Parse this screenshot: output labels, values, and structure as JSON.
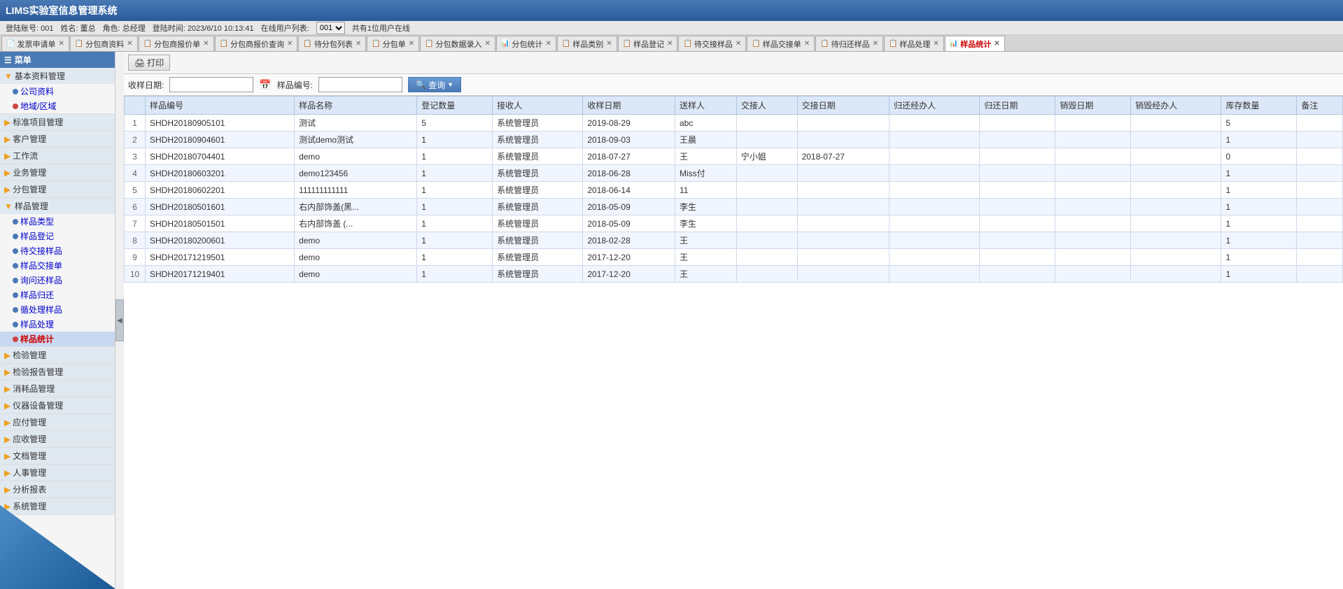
{
  "app": {
    "title": "LIMS实验室信息管理系统"
  },
  "info_bar": {
    "login_text": "登陆账号: 001",
    "name_text": "姓名: 董总",
    "role_text": "角色: 总经理",
    "login_time_text": "登陆时间: 2023/6/10 10:13:41",
    "online_text": "在线用户列表:",
    "online_select": "001",
    "online_count": "共有1位用户在线"
  },
  "tabs": [
    {
      "label": "发票申请单",
      "active": false,
      "closable": true,
      "icon": "📄"
    },
    {
      "label": "分包商资料",
      "active": false,
      "closable": true,
      "icon": "📋"
    },
    {
      "label": "分包商报价单",
      "active": false,
      "closable": true,
      "icon": "📋"
    },
    {
      "label": "分包商报价查询",
      "active": false,
      "closable": true,
      "icon": "📋"
    },
    {
      "label": "待分包列表",
      "active": false,
      "closable": true,
      "icon": "📋"
    },
    {
      "label": "分包单",
      "active": false,
      "closable": true,
      "icon": "📋"
    },
    {
      "label": "分包数据录入",
      "active": false,
      "closable": true,
      "icon": "📋"
    },
    {
      "label": "分包统计",
      "active": false,
      "closable": true,
      "icon": "📊"
    },
    {
      "label": "样品类别",
      "active": false,
      "closable": true,
      "icon": "📋"
    },
    {
      "label": "样品登记",
      "active": false,
      "closable": true,
      "icon": "📋"
    },
    {
      "label": "待交接样品",
      "active": false,
      "closable": true,
      "icon": "📋"
    },
    {
      "label": "样品交接单",
      "active": false,
      "closable": true,
      "icon": "📋"
    },
    {
      "label": "待归还样品",
      "active": false,
      "closable": true,
      "icon": "📋"
    },
    {
      "label": "样品处理",
      "active": false,
      "closable": true,
      "icon": "📋"
    },
    {
      "label": "样品统计",
      "active": true,
      "closable": true,
      "icon": "📊"
    }
  ],
  "sidebar": {
    "menu_label": "菜单",
    "groups": [
      {
        "label": "基本资料管理",
        "icon": "folder",
        "expanded": true,
        "items": [
          {
            "label": "公司资料",
            "active": false,
            "icon": "file"
          },
          {
            "label": "地域/区域",
            "active": false,
            "icon": "file"
          }
        ]
      },
      {
        "label": "标准项目管理",
        "icon": "folder",
        "expanded": false,
        "items": []
      },
      {
        "label": "客户管理",
        "icon": "folder",
        "expanded": false,
        "items": []
      },
      {
        "label": "工作流",
        "icon": "folder",
        "expanded": false,
        "items": []
      },
      {
        "label": "业务管理",
        "icon": "folder",
        "expanded": false,
        "items": []
      },
      {
        "label": "分包管理",
        "icon": "folder",
        "expanded": false,
        "items": []
      },
      {
        "label": "样品管理",
        "icon": "folder",
        "expanded": true,
        "items": [
          {
            "label": "样品类型",
            "active": false
          },
          {
            "label": "样品登记",
            "active": false
          },
          {
            "label": "待交接样品",
            "active": false
          },
          {
            "label": "样品交接单",
            "active": false
          },
          {
            "label": "询问还样品",
            "active": false
          },
          {
            "label": "样品归还",
            "active": false
          },
          {
            "label": "循处理样品",
            "active": false
          },
          {
            "label": "样品处理",
            "active": false
          },
          {
            "label": "样品统计",
            "active": true
          }
        ]
      },
      {
        "label": "检验管理",
        "icon": "folder",
        "expanded": false,
        "items": []
      },
      {
        "label": "检验报告管理",
        "icon": "folder",
        "expanded": false,
        "items": []
      },
      {
        "label": "消耗品管理",
        "icon": "folder",
        "expanded": false,
        "items": []
      },
      {
        "label": "仪器设备管理",
        "icon": "folder",
        "expanded": false,
        "items": []
      },
      {
        "label": "应付管理",
        "icon": "folder",
        "expanded": false,
        "items": []
      },
      {
        "label": "应收管理",
        "icon": "folder",
        "expanded": false,
        "items": []
      },
      {
        "label": "文档管理",
        "icon": "folder",
        "expanded": false,
        "items": []
      },
      {
        "label": "人事管理",
        "icon": "folder",
        "expanded": false,
        "items": []
      },
      {
        "label": "分析报表",
        "icon": "folder",
        "expanded": false,
        "items": []
      },
      {
        "label": "系统管理",
        "icon": "folder",
        "expanded": false,
        "items": []
      }
    ]
  },
  "toolbar": {
    "print_label": "打印",
    "print_icon": "🖨"
  },
  "search": {
    "date_label": "收样日期:",
    "date_placeholder": "",
    "sample_code_label": "样品编号:",
    "sample_code_placeholder": "",
    "search_btn_label": "查询",
    "search_icon": "🔍"
  },
  "table": {
    "columns": [
      {
        "label": "样品编号",
        "key": "sample_code"
      },
      {
        "label": "样品名称",
        "key": "sample_name"
      },
      {
        "label": "登记数量",
        "key": "reg_count"
      },
      {
        "label": "接收人",
        "key": "receiver"
      },
      {
        "label": "收样日期",
        "key": "receive_date"
      },
      {
        "label": "送样人",
        "key": "sender"
      },
      {
        "label": "交接人",
        "key": "handover"
      },
      {
        "label": "交接日期",
        "key": "handover_date"
      },
      {
        "label": "归还经办人",
        "key": "return_handler"
      },
      {
        "label": "归还日期",
        "key": "return_date"
      },
      {
        "label": "销毁日期",
        "key": "destroy_date"
      },
      {
        "label": "销毁经办人",
        "key": "destroy_handler"
      },
      {
        "label": "库存数量",
        "key": "stock_count"
      },
      {
        "label": "备注",
        "key": "note"
      }
    ],
    "rows": [
      {
        "no": 1,
        "sample_code": "SHDH20180905101",
        "sample_name": "测试",
        "reg_count": 5,
        "receiver": "系统管理员",
        "receive_date": "2019-08-29",
        "sender": "abc",
        "handover": "",
        "handover_date": "",
        "return_handler": "",
        "return_date": "",
        "destroy_date": "",
        "destroy_handler": "",
        "stock_count": 5,
        "note": ""
      },
      {
        "no": 2,
        "sample_code": "SHDH20180904601",
        "sample_name": "测试demo测试",
        "reg_count": 1,
        "receiver": "系统管理员",
        "receive_date": "2018-09-03",
        "sender": "王晨",
        "handover": "",
        "handover_date": "",
        "return_handler": "",
        "return_date": "",
        "destroy_date": "",
        "destroy_handler": "",
        "stock_count": 1,
        "note": ""
      },
      {
        "no": 3,
        "sample_code": "SHDH20180704401",
        "sample_name": "demo",
        "reg_count": 1,
        "receiver": "系统管理员",
        "receive_date": "2018-07-27",
        "sender": "王",
        "handover": "宁小姐",
        "handover_date": "2018-07-27",
        "return_handler": "",
        "return_date": "",
        "destroy_date": "",
        "destroy_handler": "",
        "stock_count": 0,
        "note": ""
      },
      {
        "no": 4,
        "sample_code": "SHDH20180603201",
        "sample_name": "demo123456",
        "reg_count": 1,
        "receiver": "系统管理员",
        "receive_date": "2018-06-28",
        "sender": "Miss付",
        "handover": "",
        "handover_date": "",
        "return_handler": "",
        "return_date": "",
        "destroy_date": "",
        "destroy_handler": "",
        "stock_count": 1,
        "note": ""
      },
      {
        "no": 5,
        "sample_code": "SHDH20180602201",
        "sample_name": "111111111111",
        "reg_count": 1,
        "receiver": "系统管理员",
        "receive_date": "2018-06-14",
        "sender": "11",
        "handover": "",
        "handover_date": "",
        "return_handler": "",
        "return_date": "",
        "destroy_date": "",
        "destroy_handler": "",
        "stock_count": 1,
        "note": ""
      },
      {
        "no": 6,
        "sample_code": "SHDH20180501601",
        "sample_name": "右内部饰盖(黑...",
        "reg_count": 1,
        "receiver": "系统管理员",
        "receive_date": "2018-05-09",
        "sender": "李生",
        "handover": "",
        "handover_date": "",
        "return_handler": "",
        "return_date": "",
        "destroy_date": "",
        "destroy_handler": "",
        "stock_count": 1,
        "note": ""
      },
      {
        "no": 7,
        "sample_code": "SHDH20180501501",
        "sample_name": "右内部饰盖 (...",
        "reg_count": 1,
        "receiver": "系统管理员",
        "receive_date": "2018-05-09",
        "sender": "李生",
        "handover": "",
        "handover_date": "",
        "return_handler": "",
        "return_date": "",
        "destroy_date": "",
        "destroy_handler": "",
        "stock_count": 1,
        "note": ""
      },
      {
        "no": 8,
        "sample_code": "SHDH20180200601",
        "sample_name": "demo",
        "reg_count": 1,
        "receiver": "系统管理员",
        "receive_date": "2018-02-28",
        "sender": "王",
        "handover": "",
        "handover_date": "",
        "return_handler": "",
        "return_date": "",
        "destroy_date": "",
        "destroy_handler": "",
        "stock_count": 1,
        "note": ""
      },
      {
        "no": 9,
        "sample_code": "SHDH20171219501",
        "sample_name": "demo",
        "reg_count": 1,
        "receiver": "系统管理员",
        "receive_date": "2017-12-20",
        "sender": "王",
        "handover": "",
        "handover_date": "",
        "return_handler": "",
        "return_date": "",
        "destroy_date": "",
        "destroy_handler": "",
        "stock_count": 1,
        "note": ""
      },
      {
        "no": 10,
        "sample_code": "SHDH20171219401",
        "sample_name": "demo",
        "reg_count": 1,
        "receiver": "系统管理员",
        "receive_date": "2017-12-20",
        "sender": "王",
        "handover": "",
        "handover_date": "",
        "return_handler": "",
        "return_date": "",
        "destroy_date": "",
        "destroy_handler": "",
        "stock_count": 1,
        "note": ""
      }
    ]
  }
}
